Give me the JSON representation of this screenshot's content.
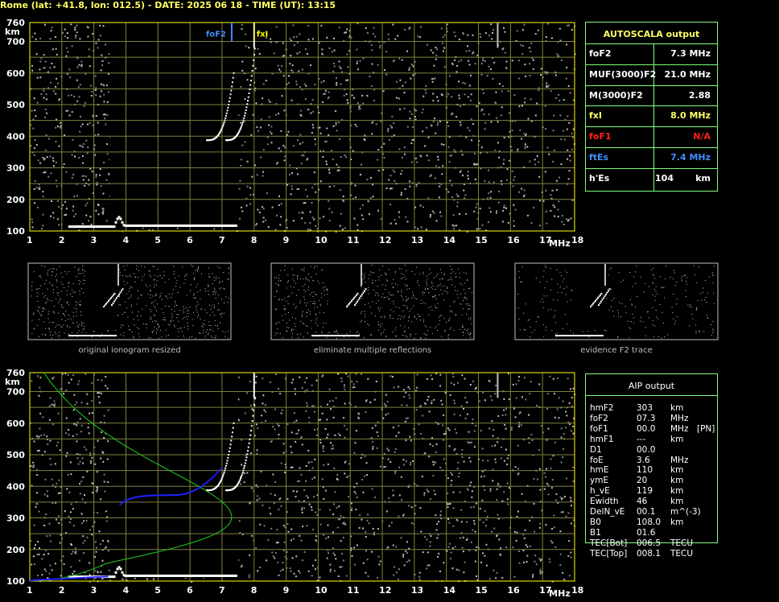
{
  "title": "Rome (lat: +41.8, lon: 012.5) - DATE: 2025 06 18 - TIME (UT): 13:15",
  "axes": {
    "y_unit": "km",
    "x_unit": "MHz",
    "y_ticks": [
      "760",
      "700",
      "600",
      "500",
      "400",
      "300",
      "200",
      "100"
    ],
    "x_ticks": [
      "1",
      "2",
      "3",
      "4",
      "5",
      "6",
      "7",
      "8",
      "9",
      "10",
      "11",
      "12",
      "13",
      "14",
      "15",
      "16",
      "17",
      "18"
    ]
  },
  "markers": {
    "foF2_label": "foF2",
    "fxI_label": "fxI"
  },
  "colors": {
    "grid": "#808040",
    "frame": "#ffff00",
    "table_border": "#7fff7f",
    "green": "#ffff66",
    "red": "#ff2020",
    "blue": "#3f8fff",
    "profile": "#20d020",
    "points": "#2020ff"
  },
  "autoscala": {
    "title": "AUTOSCALA output",
    "rows": [
      {
        "name": "foF2",
        "value": "7.3 MHz",
        "color": "#ffffff"
      },
      {
        "name": "MUF(3000)F2",
        "value": "21.0 MHz",
        "color": "#ffffff"
      },
      {
        "name": "M(3000)F2",
        "value": "2.88",
        "color": "#ffffff"
      },
      {
        "name": "fxI",
        "value": "8.0 MHz",
        "color": "#ffff66"
      },
      {
        "name": "foF1",
        "value": "N/A",
        "color": "#ff2020"
      },
      {
        "name": "ftEs",
        "value": "7.4 MHz",
        "color": "#3f8fff"
      },
      {
        "name": "h'Es",
        "value": "104",
        "unit": "km",
        "color": "#ffffff"
      }
    ]
  },
  "thumbnails": [
    {
      "caption": "original ionogram resized"
    },
    {
      "caption": "eliminate multiple reflections"
    },
    {
      "caption": "evidence F2 trace"
    }
  ],
  "aip": {
    "title": "AIP output",
    "rows": [
      {
        "name": "hmF2",
        "value": "303",
        "unit": "km",
        "extra": ""
      },
      {
        "name": "foF2",
        "value": "07.3",
        "unit": "MHz",
        "extra": ""
      },
      {
        "name": "foF1",
        "value": "00.0",
        "unit": "MHz",
        "extra": "[PN]"
      },
      {
        "name": "hmF1",
        "value": "---",
        "unit": "km",
        "extra": ""
      },
      {
        "name": "D1",
        "value": "00.0",
        "unit": "",
        "extra": ""
      },
      {
        "name": "foE",
        "value": "3.6",
        "unit": "MHz",
        "extra": ""
      },
      {
        "name": "hmE",
        "value": "110",
        "unit": "km",
        "extra": ""
      },
      {
        "name": "ymE",
        "value": "20",
        "unit": "km",
        "extra": ""
      },
      {
        "name": "h_vE",
        "value": "119",
        "unit": "km",
        "extra": ""
      },
      {
        "name": "Ewidth",
        "value": "46",
        "unit": "km",
        "extra": ""
      },
      {
        "name": "DelN_vE",
        "value": "00.1",
        "unit": "m^(-3)",
        "extra": ""
      },
      {
        "name": "B0",
        "value": "108.0",
        "unit": "km",
        "extra": ""
      },
      {
        "name": "B1",
        "value": "01.6",
        "unit": "",
        "extra": ""
      },
      {
        "name": "TEC[Bot]",
        "value": "006.5",
        "unit": "TECU",
        "extra": ""
      },
      {
        "name": "TEC[Top]",
        "value": "008.1",
        "unit": "TECU",
        "extra": ""
      }
    ]
  }
}
